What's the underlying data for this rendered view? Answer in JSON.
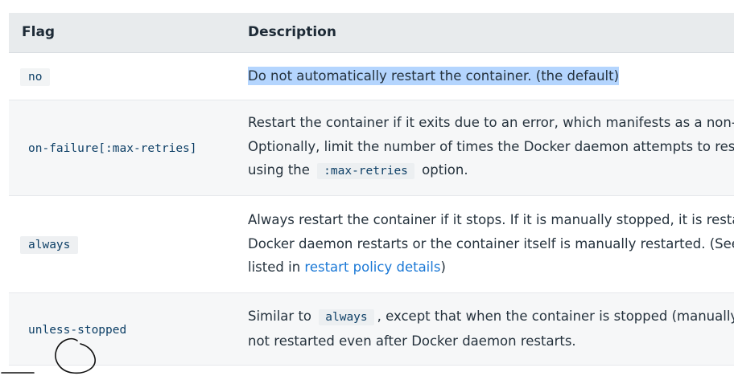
{
  "table": {
    "headers": [
      "Flag",
      "Description"
    ],
    "rows": [
      {
        "flag": "no",
        "desc": {
          "line1": "Do not automatically restart the container. (the default)"
        }
      },
      {
        "flag": "on-failure[:max-retries]",
        "desc": {
          "line1": "Restart the container if it exits due to an error, which manifests as a non-zero exit code.",
          "line2": "Optionally, limit the number of times the Docker daemon attempts to restart the container",
          "line3_pre": "using the",
          "line3_code": ":max-retries",
          "line3_post": "option."
        }
      },
      {
        "flag": "always",
        "desc": {
          "line1": "Always restart the container if it stops. If it is manually stopped, it is restarted only when",
          "line2": "Docker daemon restarts or the container itself is manually restarted. (See the second bullet",
          "line3_pre": "listed in",
          "line3_link": "restart policy details",
          "line3_post": ")"
        }
      },
      {
        "flag": "unless-stopped",
        "desc": {
          "line1_pre": "Similar to",
          "line1_code": "always",
          "line1_post": ", except that when the container is stopped (manually or otherwise), it is",
          "line2": "not restarted even after Docker daemon restarts."
        }
      }
    ]
  },
  "colors": {
    "header_bg": "#e8ebed",
    "alt_row_bg": "#f6f7f8",
    "highlight": "#b4d5fe",
    "link": "#1a78d6",
    "code_text": "#0d3f66"
  }
}
